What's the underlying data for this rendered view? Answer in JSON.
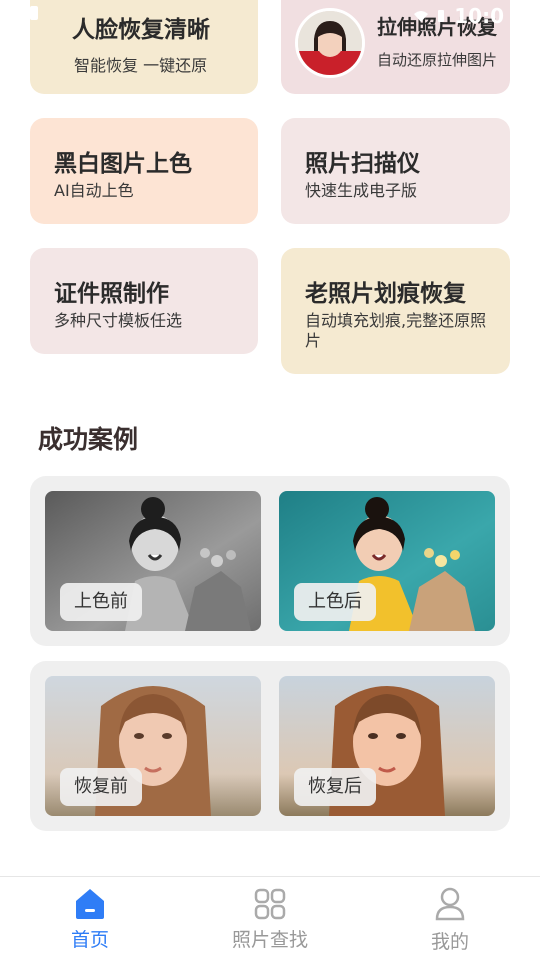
{
  "status_bar": {
    "time": "10:0"
  },
  "features": [
    {
      "title": "人脸恢复清晰",
      "subtitle": "智能恢复 一键还原"
    },
    {
      "title": "拉伸照片恢复",
      "subtitle": "自动还原拉伸图片"
    },
    {
      "title": "黑白图片上色",
      "subtitle": "AI自动上色"
    },
    {
      "title": "照片扫描仪",
      "subtitle": "快速生成电子版"
    },
    {
      "title": "证件照制作",
      "subtitle": "多种尺寸模板任选"
    },
    {
      "title": "老照片划痕恢复",
      "subtitle": "自动填充划痕,完整还原照片"
    }
  ],
  "cases": {
    "title": "成功案例",
    "items": [
      {
        "before_label": "上色前",
        "after_label": "上色后"
      },
      {
        "before_label": "恢复前",
        "after_label": "恢复后"
      }
    ]
  },
  "tabbar": {
    "items": [
      {
        "label": "首页",
        "icon": "home-icon",
        "active": true
      },
      {
        "label": "照片查找",
        "icon": "grid-icon",
        "active": false
      },
      {
        "label": "我的",
        "icon": "user-icon",
        "active": false
      }
    ],
    "active_color": "#2f7df6",
    "inactive_color": "#999999"
  }
}
